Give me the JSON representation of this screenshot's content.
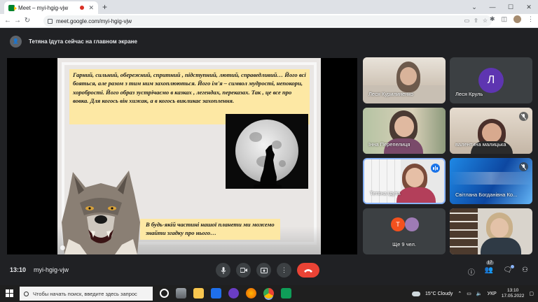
{
  "browser": {
    "tab_title": "Meet – myi-hgig-vjw",
    "tab_close": "✕",
    "new_tab": "+",
    "url": "meet.google.com/myi-hgig-vjw",
    "window_controls": [
      "⌄",
      "—",
      "☐",
      "✕"
    ]
  },
  "meet": {
    "presenter_banner": "Тетяна Ідута сейчас на главном экране",
    "slide": {
      "text": "Гарний, сильний, обережний, спритний , підступний, лютий, справедливий… Його всі бояться, але разом з тим ним захоплюються. Його ім'я – символ мудрості, непокори, хоробрості. Його образ зустрічаємо в казках , легендах, переказах. Так , це все про вовка. Для когось він хижак, а в когось викликає захоплення.",
      "quote": "В будь-якій частині нашої планети ми можемо знайти згадку про нього…"
    },
    "participants": [
      {
        "name": "Леся Курилиненко",
        "state": "video"
      },
      {
        "name": "Леся Круль",
        "state": "avatar",
        "initial": "Л"
      },
      {
        "name": "Інна Перепелиця",
        "state": "video"
      },
      {
        "name": "валентина малицька",
        "state": "video-muted"
      },
      {
        "name": "Тетяна Ідута",
        "state": "speaking"
      },
      {
        "name": "Світлана Богданівна Ко...",
        "state": "video-muted"
      },
      {
        "name": "Ще 9 чел.",
        "state": "more",
        "initial": "Т"
      },
      {
        "name": "",
        "state": "video"
      }
    ],
    "controls": {
      "time": "13:10",
      "meeting_code": "myi-hgig-vjw",
      "participant_count": "17"
    }
  },
  "taskbar": {
    "search_placeholder": "Чтобы начать поиск, введите здесь запрос",
    "weather": "15°C  Cloudy",
    "language": "УКР",
    "time": "13:10",
    "date": "17.05.2022"
  },
  "colors": {
    "meet_bg": "#202124",
    "end_call": "#ea4335",
    "slide_highlight": "#fde8a4",
    "avatar_purple": "#5e35b1",
    "speaking_blue": "#1a73e8"
  }
}
